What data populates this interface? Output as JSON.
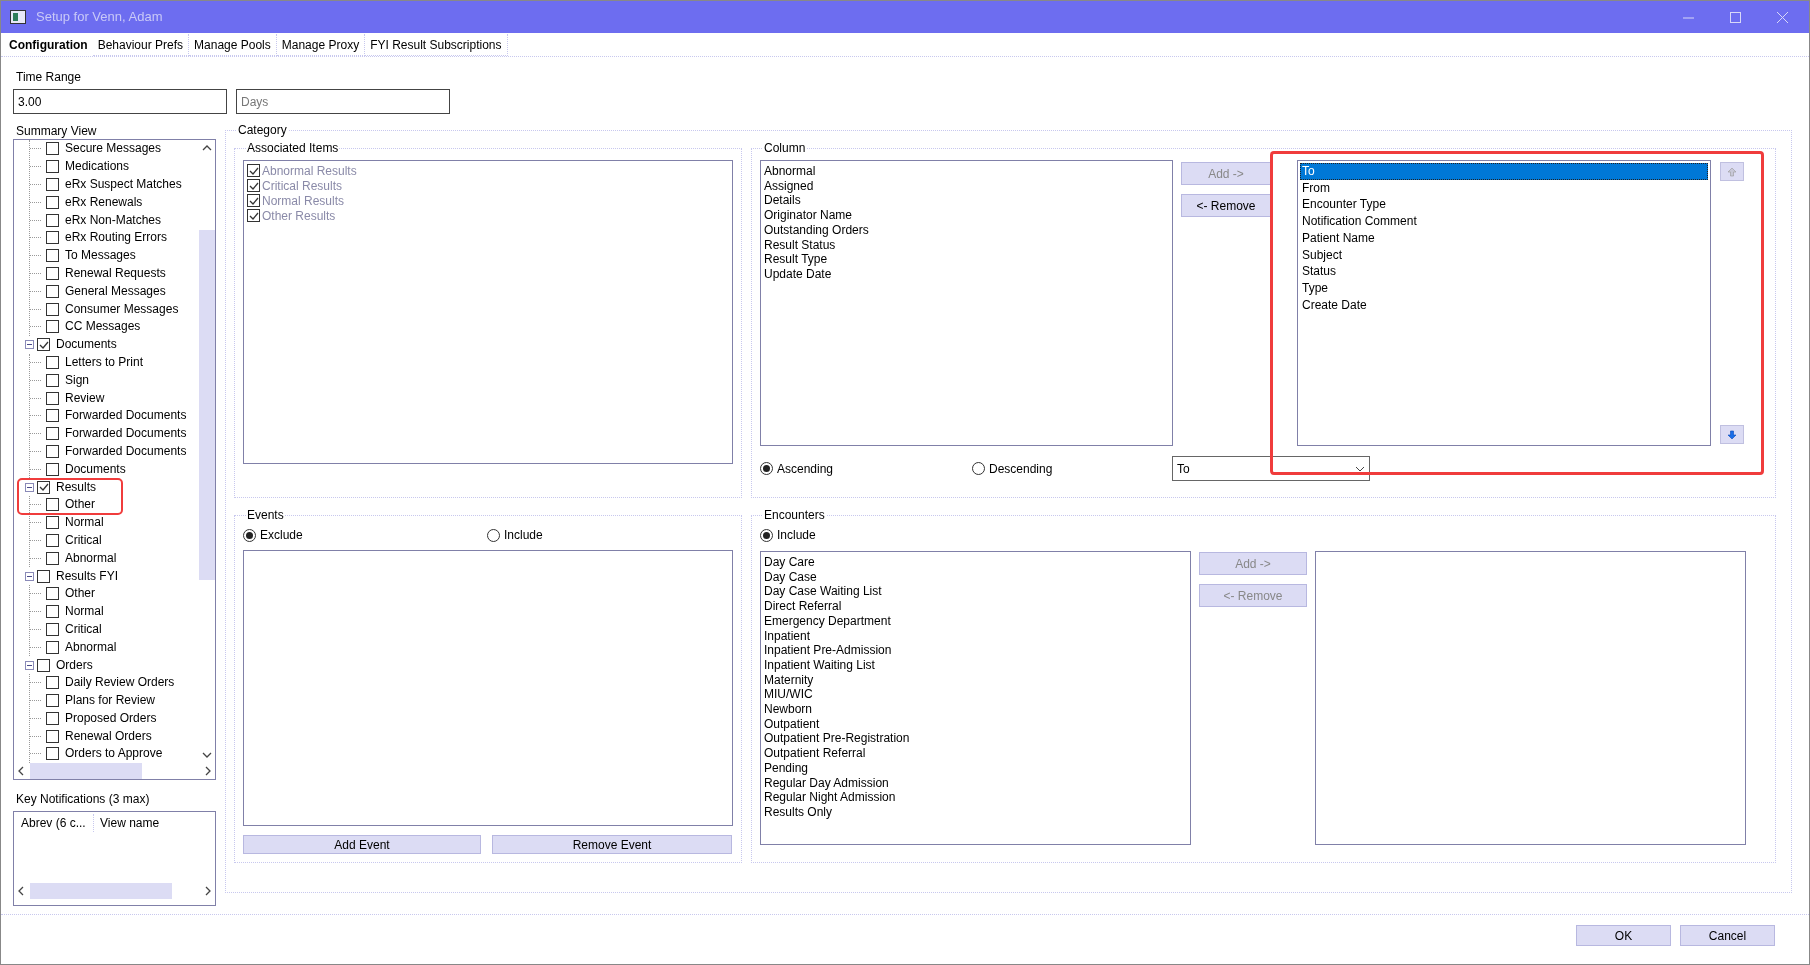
{
  "window": {
    "title": "Setup for Venn, Adam"
  },
  "tabs": [
    {
      "label": "Configuration",
      "selected": true
    },
    {
      "label": "Behaviour Prefs",
      "selected": false
    },
    {
      "label": "Manage Pools",
      "selected": false
    },
    {
      "label": "Manage Proxy",
      "selected": false
    },
    {
      "label": "FYI Result Subscriptions",
      "selected": false
    }
  ],
  "time_range": {
    "label": "Time Range",
    "value": "3.00",
    "unit": "Days"
  },
  "summary_view": {
    "label": "Summary View",
    "tree": [
      {
        "children": [
          {
            "label": "Secure Messages",
            "checked": false
          },
          {
            "label": "Medications",
            "checked": false
          },
          {
            "label": "eRx Suspect Matches",
            "checked": false
          },
          {
            "label": "eRx Renewals",
            "checked": false
          },
          {
            "label": "eRx Non-Matches",
            "checked": false
          },
          {
            "label": "eRx Routing Errors",
            "checked": false
          },
          {
            "label": "To Messages",
            "checked": false
          },
          {
            "label": "Renewal Requests",
            "checked": false
          },
          {
            "label": "General Messages",
            "checked": false
          },
          {
            "label": "Consumer Messages",
            "checked": false
          },
          {
            "label": "CC Messages",
            "checked": false
          }
        ]
      },
      {
        "label": "Documents",
        "checked": true,
        "expanded": true,
        "children": [
          {
            "label": "Letters to Print",
            "checked": false
          },
          {
            "label": "Sign",
            "checked": false
          },
          {
            "label": "Review",
            "checked": false
          },
          {
            "label": "Forwarded Documents",
            "checked": false
          },
          {
            "label": "Forwarded Documents",
            "checked": false
          },
          {
            "label": "Forwarded Documents",
            "checked": false
          },
          {
            "label": "Documents",
            "checked": false
          }
        ]
      },
      {
        "label": "Results",
        "checked": true,
        "expanded": true,
        "children": [
          {
            "label": "Other",
            "checked": false
          },
          {
            "label": "Normal",
            "checked": false
          },
          {
            "label": "Critical",
            "checked": false
          },
          {
            "label": "Abnormal",
            "checked": false
          }
        ]
      },
      {
        "label": "Results FYI",
        "checked": false,
        "expanded": true,
        "children": [
          {
            "label": "Other",
            "checked": false
          },
          {
            "label": "Normal",
            "checked": false
          },
          {
            "label": "Critical",
            "checked": false
          },
          {
            "label": "Abnormal",
            "checked": false
          }
        ]
      },
      {
        "label": "Orders",
        "checked": false,
        "expanded": true,
        "children": [
          {
            "label": "Daily Review Orders",
            "checked": false
          },
          {
            "label": "Plans for Review",
            "checked": false
          },
          {
            "label": "Proposed Orders",
            "checked": false
          },
          {
            "label": "Renewal Orders",
            "checked": false
          },
          {
            "label": "Orders to Approve",
            "checked": false
          }
        ]
      }
    ]
  },
  "key_notifications": {
    "label": "Key Notifications (3 max)",
    "columns": [
      "Abrev (6 c...",
      "View name"
    ]
  },
  "category": {
    "label": "Category",
    "associated_items": {
      "label": "Associated Items",
      "disabled": true,
      "items": [
        {
          "label": "Abnormal Results",
          "checked": true
        },
        {
          "label": "Critical Results",
          "checked": true
        },
        {
          "label": "Normal Results",
          "checked": true
        },
        {
          "label": "Other Results",
          "checked": true
        }
      ]
    },
    "column": {
      "label": "Column",
      "available": [
        "Abnormal",
        "Assigned",
        "Details",
        "Originator Name",
        "Outstanding Orders",
        "Result Status",
        "Result Type",
        "Update Date"
      ],
      "add_button": {
        "label": "Add ->",
        "disabled": true
      },
      "remove_button": {
        "label": "<- Remove",
        "disabled": false
      },
      "chosen": [
        {
          "label": "To",
          "selected": true
        },
        {
          "label": "From",
          "selected": false
        },
        {
          "label": "Encounter Type",
          "selected": false
        },
        {
          "label": "Notification Comment",
          "selected": false
        },
        {
          "label": "Patient Name",
          "selected": false
        },
        {
          "label": "Subject",
          "selected": false
        },
        {
          "label": "Status",
          "selected": false
        },
        {
          "label": "Type",
          "selected": false
        },
        {
          "label": "Create Date",
          "selected": false
        }
      ],
      "move_up": {
        "disabled": true
      },
      "move_down": {
        "disabled": false
      },
      "sort": [
        {
          "label": "Ascending",
          "selected": true
        },
        {
          "label": "Descending",
          "selected": false
        }
      ],
      "sort_by": "To"
    },
    "events": {
      "label": "Events",
      "modes": [
        {
          "label": "Exclude",
          "selected": true
        },
        {
          "label": "Include",
          "selected": false
        }
      ],
      "buttons": [
        {
          "label": "Add Event",
          "disabled": false
        },
        {
          "label": "Remove Event",
          "disabled": false
        }
      ]
    },
    "encounters": {
      "label": "Encounters",
      "modes": [
        {
          "label": "Include",
          "selected": true
        }
      ],
      "available": [
        "Day Care",
        "Day Case",
        "Day Case Waiting List",
        "Direct Referral",
        "Emergency Department",
        "Inpatient",
        "Inpatient Pre-Admission",
        "Inpatient Waiting List",
        "Maternity",
        "MIU/WIC",
        "Newborn",
        "Outpatient",
        "Outpatient Pre-Registration",
        "Outpatient Referral",
        "Pending",
        "Regular Day Admission",
        "Regular Night Admission",
        "Results Only"
      ],
      "add_button": {
        "label": "Add ->",
        "disabled": true
      },
      "remove_button": {
        "label": "<- Remove",
        "disabled": true
      }
    }
  },
  "buttons": [
    {
      "label": "OK",
      "disabled": false
    },
    {
      "label": "Cancel",
      "disabled": false
    }
  ]
}
